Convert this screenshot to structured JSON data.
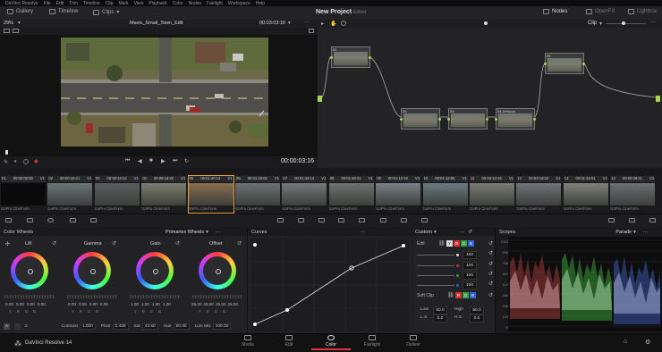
{
  "menubar": {
    "items": [
      "DaVinci Resolve",
      "File",
      "Edit",
      "Trim",
      "Timeline",
      "Clip",
      "Mark",
      "View",
      "Playback",
      "Color",
      "Nodes",
      "Fairlight",
      "Workspace",
      "Help"
    ]
  },
  "toolbar": {
    "gallery": "Gallery",
    "timeline": "Timeline",
    "clips": "Clips",
    "project_title": "New Project",
    "project_status": "Edited",
    "nodes": "Nodes",
    "openfx": "OpenFX",
    "lightbox": "Lightbox"
  },
  "viewer": {
    "zoom": "29%",
    "clip_name": "Mavis_Small_Town_Edit",
    "timecode_top": "00:03:03:16",
    "timecode": "00:00:03:16"
  },
  "node_editor": {
    "mode": "Clip",
    "nodes": [
      {
        "label": "01"
      },
      {
        "label": "02"
      },
      {
        "label": "03"
      },
      {
        "label": "04 Defocus"
      },
      {
        "label": "05"
      },
      {
        "label": "06"
      }
    ]
  },
  "clips": [
    {
      "num": "01",
      "tc": "00:00:00:00",
      "track": "V1",
      "label": "GoPro CineForm",
      "color": "#0a0a0a"
    },
    {
      "num": "02",
      "tc": "00:00:16:21",
      "track": "V1",
      "label": "GoPro CineForm",
      "color": "#6b7376"
    },
    {
      "num": "03",
      "tc": "00:00:18:13",
      "track": "V1",
      "label": "GoPro CineForm",
      "color": "#5a5e5e"
    },
    {
      "num": "04",
      "tc": "00:00:18:20",
      "track": "V1",
      "label": "GoPro CineForm",
      "color": "#7d7e70"
    },
    {
      "num": "05",
      "tc": "00:01:40:12",
      "track": "V1",
      "label": "GoPro CineForm",
      "color": "#8a7050"
    },
    {
      "num": "06",
      "tc": "00:01:43:02",
      "track": "V1",
      "label": "GoPro CineForm",
      "color": "#6a7272"
    },
    {
      "num": "07",
      "tc": "00:01:44:14",
      "track": "V1",
      "label": "GoPro CineForm",
      "color": "#73787a"
    },
    {
      "num": "08",
      "tc": "00:01:49:21",
      "track": "V1",
      "label": "GoPro CineForm",
      "color": "#6e7370"
    },
    {
      "num": "09",
      "tc": "00:01:12:22",
      "track": "V1",
      "label": "GoPro CineForm",
      "color": "#7a8088"
    },
    {
      "num": "10",
      "tc": "00:01:13:05",
      "track": "V1",
      "label": "GoPro CineForm",
      "color": "#6a7a80"
    },
    {
      "num": "11",
      "tc": "00:03:13:16",
      "track": "V1",
      "label": "GoPro CineForm",
      "color": "#7b7d73"
    },
    {
      "num": "12",
      "tc": "00:03:13:22",
      "track": "V1",
      "label": "GoPro CineForm",
      "color": "#6f7478"
    },
    {
      "num": "13",
      "tc": "00:01:33:01",
      "track": "V1",
      "label": "GoPro CineForm",
      "color": "#80827a"
    },
    {
      "num": "14",
      "tc": "00:00:39:21",
      "track": "V1",
      "label": "GoPro CineForm",
      "color": "#6c7074"
    }
  ],
  "color_wheels": {
    "title": "Color Wheels",
    "mode": "Primaries Wheels",
    "wheels": [
      {
        "name": "Lift",
        "values": [
          "0.00",
          "0.00",
          "0.00",
          "0.00"
        ]
      },
      {
        "name": "Gamma",
        "values": [
          "0.00",
          "0.00",
          "0.00",
          "0.00"
        ]
      },
      {
        "name": "Gain",
        "values": [
          "1.00",
          "1.00",
          "1.00",
          "1.00"
        ]
      },
      {
        "name": "Offset",
        "values": [
          "25.00",
          "25.00",
          "25.00",
          "25.00"
        ]
      }
    ],
    "channel_keys": [
      "Y",
      "R",
      "G",
      "B"
    ],
    "page_num": "2",
    "contrast_label": "Contrast",
    "contrast": "1.000",
    "pivot_label": "Pivot",
    "pivot": "0.435",
    "sat_label": "Sat",
    "sat": "43.60",
    "hue_label": "Hue",
    "hue": "50.00",
    "lummix_label": "Lum Mix",
    "lummix": "100.00"
  },
  "curves": {
    "title": "Curves",
    "mode": "Custom"
  },
  "edit_panel": {
    "title": "Edit",
    "values": [
      "100",
      "100",
      "100",
      "100"
    ],
    "soft_clip": "Soft Clip",
    "low_label": "Low",
    "low": "50.0",
    "high_label": "High",
    "high": "50.0",
    "ls_label": "L.S.",
    "ls": "0.0",
    "hs_label": "H.S.",
    "hs": "0.0"
  },
  "scopes": {
    "title": "Scopes",
    "mode": "Parade",
    "ticks": [
      "1023",
      "896",
      "768",
      "640",
      "512",
      "384",
      "256",
      "128",
      "0"
    ]
  },
  "bottom": {
    "app_name": "DaVinci Resolve 14",
    "pages": [
      "Media",
      "Edit",
      "Color",
      "Fairlight",
      "Deliver"
    ],
    "active_page": "Color"
  },
  "colors": {
    "accent": "#e0343a",
    "node_dot": "#a6d94a",
    "clip_selected": "#e8a23a"
  }
}
